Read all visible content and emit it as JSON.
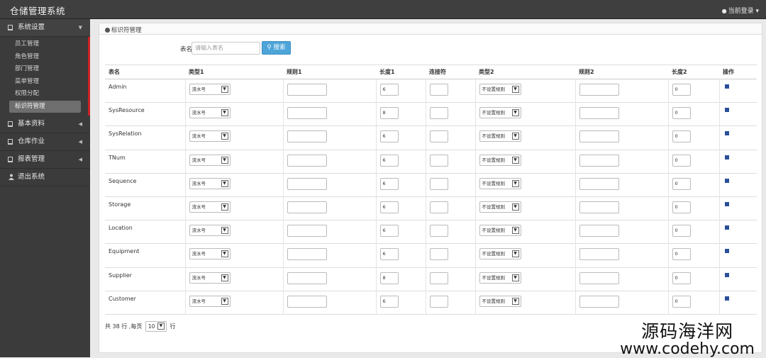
{
  "app_title": "仓储管理系统",
  "user_menu": "当前登录",
  "sidebar": {
    "groups": [
      {
        "label": "系统设置",
        "open": true
      },
      {
        "label": "基本资料"
      },
      {
        "label": "仓库作业"
      },
      {
        "label": "报表管理"
      },
      {
        "label": "退出系统"
      }
    ],
    "sub": [
      "员工管理",
      "角色管理",
      "部门管理",
      "菜单管理",
      "权限分配",
      "标识符管理"
    ]
  },
  "breadcrumb": "标识符管理",
  "search": {
    "label": "表名",
    "placeholder": "请输入表名",
    "button": "搜索"
  },
  "table": {
    "headers": [
      "表名",
      "类型1",
      "规则1",
      "长度1",
      "连接符",
      "类型2",
      "规则2",
      "长度2",
      "操作"
    ],
    "rows": [
      {
        "name": "Admin",
        "type1": "流水号",
        "len1": "6",
        "type2": "不设置规则",
        "len2": "0"
      },
      {
        "name": "SysResource",
        "type1": "流水号",
        "len1": "8",
        "type2": "不设置规则",
        "len2": "0"
      },
      {
        "name": "SysRelation",
        "type1": "流水号",
        "len1": "6",
        "type2": "不设置规则",
        "len2": "0"
      },
      {
        "name": "TNum",
        "type1": "流水号",
        "len1": "6",
        "type2": "不设置规则",
        "len2": "0"
      },
      {
        "name": "Sequence",
        "type1": "流水号",
        "len1": "6",
        "type2": "不设置规则",
        "len2": "0"
      },
      {
        "name": "Storage",
        "type1": "流水号",
        "len1": "6",
        "type2": "不设置规则",
        "len2": "0"
      },
      {
        "name": "Location",
        "type1": "流水号",
        "len1": "6",
        "type2": "不设置规则",
        "len2": "0"
      },
      {
        "name": "Equipment",
        "type1": "流水号",
        "len1": "6",
        "type2": "不设置规则",
        "len2": "0"
      },
      {
        "name": "Supplier",
        "type1": "流水号",
        "len1": "8",
        "type2": "不设置规则",
        "len2": "0"
      },
      {
        "name": "Customer",
        "type1": "流水号",
        "len1": "6",
        "type2": "不设置规则",
        "len2": "0"
      }
    ]
  },
  "pagination": {
    "prefix": "共 38 行 ,每页",
    "page_size": "10",
    "suffix": "行"
  },
  "watermark": {
    "line1": "源码海洋网",
    "line2": "www.codehy.com"
  }
}
